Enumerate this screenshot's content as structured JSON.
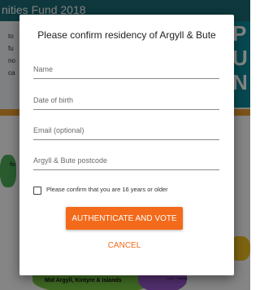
{
  "background": {
    "header_text": "nities Fund 2018",
    "side_texts": [
      "to",
      "fu",
      "no",
      "ca"
    ],
    "hero_letters": [
      "P",
      "U",
      "N"
    ],
    "map_side_label": "fin",
    "map_label": "Mid Argyll, Kintyre & Islands",
    "map_label_small": "Loch... Islands"
  },
  "colors": {
    "header_bg": "#1b6c75",
    "accent_orange": "#f36a1a",
    "overlay": "rgba(0,0,0,0.48)"
  },
  "modal": {
    "title": "Please confirm residency of Argyll & Bute",
    "fields": {
      "name": {
        "placeholder": "Name",
        "value": ""
      },
      "dob": {
        "placeholder": "Date of birth",
        "value": ""
      },
      "email": {
        "placeholder": "Email (optional)",
        "value": ""
      },
      "postcode": {
        "placeholder": "Argyll & Bute postcode",
        "value": ""
      }
    },
    "consent_label": "Please confirm that you are 16 years or older",
    "consent_checked": false,
    "primary_button": "Authenticate and vote",
    "cancel_button": "Cancel"
  }
}
